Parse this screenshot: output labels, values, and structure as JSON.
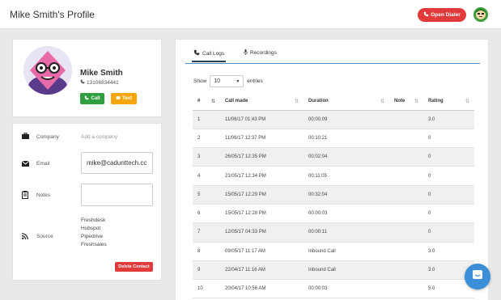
{
  "header": {
    "title": "Mike Smith's Profile",
    "dialer_label": "Open Dialer"
  },
  "profile": {
    "name": "Mike Smith",
    "phone": "13106834441",
    "call_label": "Call",
    "text_label": "Text"
  },
  "details": {
    "company_label": "Company",
    "company_value": "Add a company",
    "email_label": "Email",
    "email_value": "mike@cadunttech.cc",
    "notes_label": "Notes",
    "notes_value": "",
    "source_label": "Source",
    "sources": [
      "Freshdesk",
      "Hubspot",
      "Pipedrive",
      "Freshsales"
    ],
    "delete_label": "Delete Contact"
  },
  "tabs": [
    {
      "label": "Call Logs",
      "icon": "phone-icon"
    },
    {
      "label": "Recordings",
      "icon": "microphone-icon"
    }
  ],
  "table_controls": {
    "show_label": "Show",
    "entries_value": "10",
    "entries_label": "entries"
  },
  "table": {
    "columns": [
      "#",
      "Call made",
      "Duration",
      "Note",
      "Rating"
    ],
    "rows": [
      [
        "1",
        "11/06/17 01:43 PM",
        "00:00:09",
        "",
        "3.0"
      ],
      [
        "2",
        "11/06/17 12:37 PM",
        "00:10:21",
        "",
        "0"
      ],
      [
        "3",
        "26/05/17 12:35 PM",
        "00:02:04",
        "",
        "0"
      ],
      [
        "4",
        "21/05/17 12:34 PM",
        "00:11:05",
        "",
        "0"
      ],
      [
        "5",
        "15/05/17 12:29 PM",
        "00:32:04",
        "",
        "0"
      ],
      [
        "6",
        "15/05/17 12:28 PM",
        "00:00:03",
        "",
        "0"
      ],
      [
        "7",
        "12/05/17 04:33 PM",
        "00:00:11",
        "",
        "0"
      ],
      [
        "8",
        "09/05/17 11:17 AM",
        "Inbound Call",
        "",
        "3.0"
      ],
      [
        "9",
        "22/04/17 11:16 AM",
        "Inbound Call",
        "",
        "3.0"
      ],
      [
        "10",
        "20/04/17 10:56 AM",
        "00:00:03",
        "",
        "5.0"
      ]
    ]
  },
  "colors": {
    "dialer": "#e03a3a",
    "call": "#2e9e3e",
    "text": "#f4a60c",
    "delete": "#e03a3a",
    "tab_underline": "#4a90c8",
    "chat": "#3a8fd8"
  }
}
